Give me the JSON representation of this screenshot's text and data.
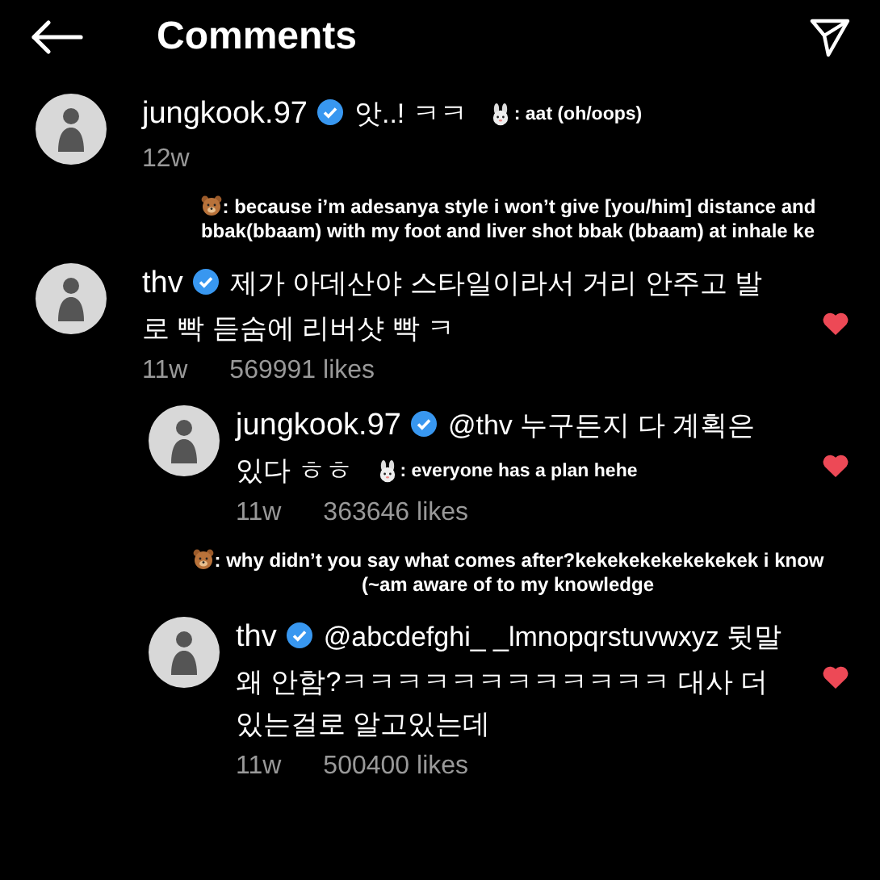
{
  "header": {
    "title": "Comments"
  },
  "items": [
    {
      "kind": "comment",
      "reply": false,
      "username": "jungkook.97",
      "verified": true,
      "text": "앗..! ㅋㅋ",
      "inline_caption": {
        "icon": {
          "kind": "rabbit"
        },
        "text": ": aat (oh/oops)"
      },
      "time": "12w",
      "liked": false
    },
    {
      "kind": "caption",
      "icon": {
        "kind": "bear"
      },
      "text": ": because i’m adesanya style i won’t give [you/him] distance and bbak(bbaam) with my foot and liver shot bbak (bbaam) at inhale ke"
    },
    {
      "kind": "comment",
      "reply": false,
      "username": "thv",
      "verified": true,
      "text": "제가 아데산야 스타일이라서 거리 안주고 발로 빡 듣숨에 리버샷 빡 ㅋ",
      "time": "11w",
      "likes": "569991 likes",
      "liked": true
    },
    {
      "kind": "comment",
      "reply": true,
      "username": "jungkook.97",
      "verified": true,
      "text": "@thv 누구든지 다 계획은 있다 ㅎㅎ",
      "inline_caption": {
        "icon": {
          "kind": "rabbit"
        },
        "text": ": everyone has a plan hehe"
      },
      "time": "11w",
      "likes": "363646 likes",
      "liked": true
    },
    {
      "kind": "caption",
      "icon": {
        "kind": "bear"
      },
      "text": ": why didn’t you say what comes after?kekekekekekekekek i know (~am aware of to my knowledge"
    },
    {
      "kind": "comment",
      "reply": true,
      "username": "thv",
      "verified": true,
      "text": "@abcdefghi_ _lmnopqrstuvwxyz  뒷말 왜 안함?ㅋㅋㅋㅋㅋㅋㅋㅋㅋㅋㅋㅋ 대사 더 있는걸로 알고있는데",
      "time": "11w",
      "likes": "500400 likes",
      "liked": true
    }
  ]
}
